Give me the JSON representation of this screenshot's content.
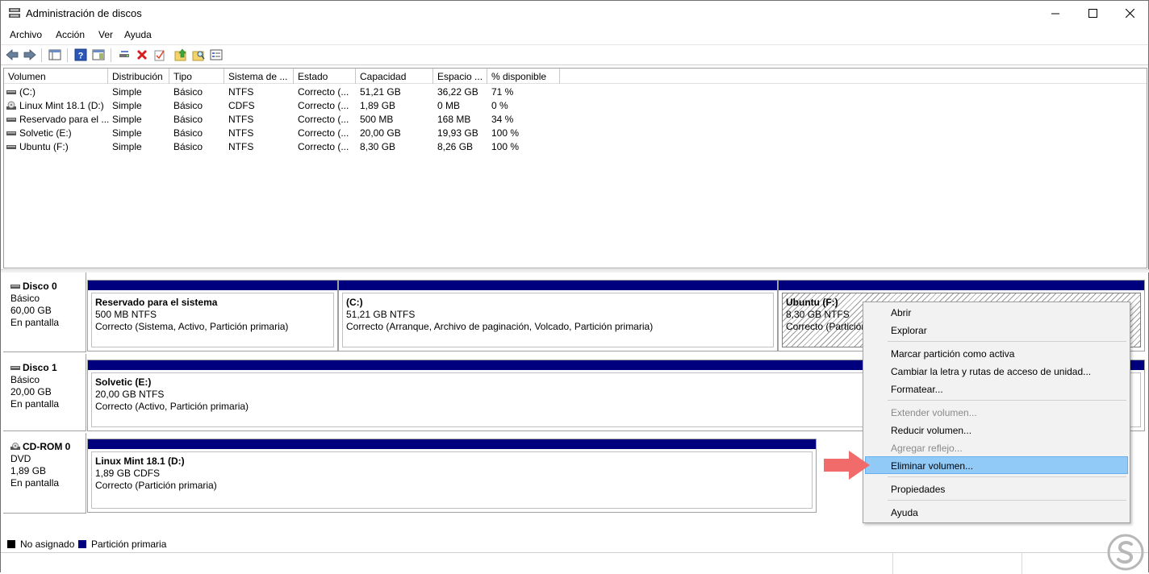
{
  "window": {
    "title": "Administración de discos",
    "min": "—",
    "max": "☐",
    "close": "✕"
  },
  "menu": [
    "Archivo",
    "Acción",
    "Ver",
    "Ayuda"
  ],
  "list": {
    "columns": [
      "Volumen",
      "Distribución",
      "Tipo",
      "Sistema de ...",
      "Estado",
      "Capacidad",
      "Espacio ...",
      "% disponible"
    ],
    "rows": [
      {
        "icon": "drive-icon",
        "vol": "(C:)",
        "dist": "Simple",
        "tipo": "Básico",
        "fs": "NTFS",
        "estado": "Correcto (...",
        "cap": "51,21 GB",
        "free": "36,22 GB",
        "pct": "71 %"
      },
      {
        "icon": "cd-icon",
        "vol": "Linux Mint 18.1 (D:)",
        "dist": "Simple",
        "tipo": "Básico",
        "fs": "CDFS",
        "estado": "Correcto (...",
        "cap": "1,89 GB",
        "free": "0 MB",
        "pct": "0 %"
      },
      {
        "icon": "drive-icon",
        "vol": "Reservado para el ...",
        "dist": "Simple",
        "tipo": "Básico",
        "fs": "NTFS",
        "estado": "Correcto (...",
        "cap": "500 MB",
        "free": "168 MB",
        "pct": "34 %"
      },
      {
        "icon": "drive-icon",
        "vol": "Solvetic (E:)",
        "dist": "Simple",
        "tipo": "Básico",
        "fs": "NTFS",
        "estado": "Correcto (...",
        "cap": "20,00 GB",
        "free": "19,93 GB",
        "pct": "100 %"
      },
      {
        "icon": "drive-icon",
        "vol": "Ubuntu (F:)",
        "dist": "Simple",
        "tipo": "Básico",
        "fs": "NTFS",
        "estado": "Correcto (...",
        "cap": "8,30 GB",
        "free": "8,26 GB",
        "pct": "100 %"
      }
    ]
  },
  "disks": [
    {
      "name": "Disco 0",
      "type": "Básico",
      "size": "60,00 GB",
      "status": "En pantalla",
      "partitions": [
        {
          "name": "Reservado para el sistema",
          "size": "500 MB NTFS",
          "status": "Correcto (Sistema, Activo, Partición primaria)"
        },
        {
          "name": "(C:)",
          "size": "51,21 GB NTFS",
          "status": "Correcto (Arranque, Archivo de paginación, Volcado, Partición primaria)"
        },
        {
          "name": "Ubuntu  (F:)",
          "size": "8,30 GB NTFS",
          "status": "Correcto (Partición"
        }
      ]
    },
    {
      "name": "Disco 1",
      "type": "Básico",
      "size": "20,00 GB",
      "status": "En pantalla",
      "partitions": [
        {
          "name": "Solvetic  (E:)",
          "size": "20,00 GB NTFS",
          "status": "Correcto (Activo, Partición primaria)"
        }
      ]
    },
    {
      "name": "CD-ROM 0",
      "type": "DVD",
      "size": "1,89 GB",
      "status": "En pantalla",
      "partitions": [
        {
          "name": "Linux Mint 18.1  (D:)",
          "size": "1,89 GB CDFS",
          "status": "Correcto (Partición primaria)"
        }
      ]
    }
  ],
  "legend": [
    {
      "label": "No asignado",
      "color": "#000000"
    },
    {
      "label": "Partición primaria",
      "color": "#00007f"
    }
  ],
  "context_menu": [
    {
      "label": "Abrir",
      "enabled": true
    },
    {
      "label": "Explorar",
      "enabled": true
    },
    {
      "label": "Marcar partición como activa",
      "enabled": true
    },
    {
      "label": "Cambiar la letra y rutas de acceso de unidad...",
      "enabled": true
    },
    {
      "label": "Formatear...",
      "enabled": true
    },
    {
      "label": "Extender volumen...",
      "enabled": false
    },
    {
      "label": "Reducir volumen...",
      "enabled": true
    },
    {
      "label": "Agregar reflejo...",
      "enabled": false
    },
    {
      "label": "Eliminar volumen...",
      "enabled": true,
      "highlighted": true
    },
    {
      "label": "Propiedades",
      "enabled": true
    },
    {
      "label": "Ayuda",
      "enabled": true
    }
  ],
  "colors": {
    "primary_partition": "#00007f",
    "highlight": "#91c9f7",
    "arrow": "#f26b6b"
  }
}
